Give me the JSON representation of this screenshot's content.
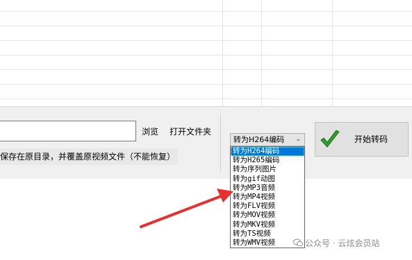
{
  "toolbar": {
    "browse_label": "浏览",
    "open_folder_label": "打开文件夹",
    "save_option_text": "保存在原目录，并覆盖原视频文件（不能恢复）"
  },
  "format_select": {
    "selected": "转为H264编码",
    "options": [
      "转为H264编码",
      "转为H265编码",
      "转为序列图片",
      "转为gif动图",
      "转为MP3音频",
      "转为MP4视频",
      "转为FLV视频",
      "转为MOV视频",
      "转为MKV视频",
      "转为TS视频",
      "转为WMV视频"
    ],
    "highlighted_index": 0
  },
  "start_button": {
    "label": "开始转码"
  },
  "watermark": {
    "text": "公众号 · 云炫会员站"
  },
  "colors": {
    "selection": "#0078d7",
    "arrow": "#e8312f",
    "check": "#2f9e2f"
  },
  "icons": {
    "start": "check-icon",
    "watermark": "wechat-icon"
  }
}
